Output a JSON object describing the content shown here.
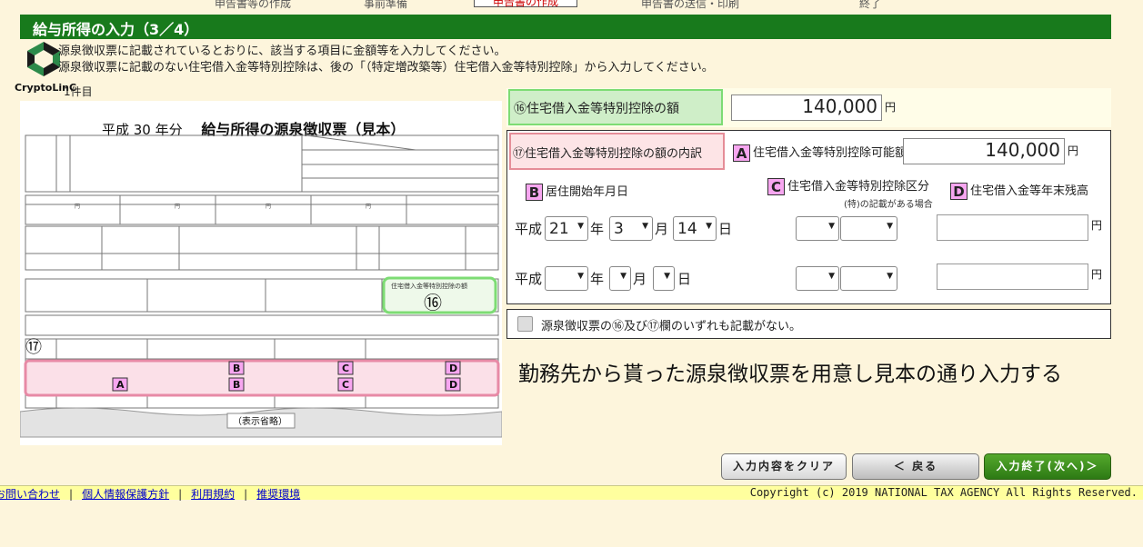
{
  "nav": {
    "items": [
      "申告書等の作成",
      "事前準備",
      "申告書の作成",
      "申告書の送信・印刷",
      "終了"
    ]
  },
  "page": {
    "title": "給与所得の入力（3／4）",
    "note1": "源泉徴収票に記載されているとおりに、該当する項目に金額等を入力してください。",
    "note2": "源泉徴収票に記載のない住宅借入金等特別控除は、後の「（特定増改築等）住宅借入金等特別控除」から入力してください。",
    "item_count": "1件目"
  },
  "logo": {
    "text": "CryptoLinC"
  },
  "sample": {
    "year_label": "平成 30 年分",
    "title": "給与所得の源泉徴収票（見本）",
    "field_16_label": "住宅借入金等特別控除の額",
    "circle_16": "⑯",
    "circle_17": "⑰",
    "omitted": "（表示省略）",
    "badges": [
      "A",
      "B",
      "C",
      "D"
    ]
  },
  "form": {
    "r16_label": "⑯住宅借入金等特別控除の額",
    "r16_value": "140,000",
    "yen": "円",
    "r17_label": "⑰住宅借入金等特別控除の額の内訳",
    "a_label": "住宅借入金等特別控除可能額",
    "a_value": "140,000",
    "b_label": "居住開始年月日",
    "c_label": "住宅借入金等特別控除区分",
    "c_sub": "(特)の記載がある場合",
    "d_label": "住宅借入金等年末残高",
    "era": "平成",
    "year_unit": "年",
    "month_unit": "月",
    "day_unit": "日",
    "row1": {
      "year": "21",
      "month": "3",
      "day": "14",
      "kubun1": "",
      "kubun2": "",
      "balance": ""
    },
    "row2": {
      "year": "",
      "month": "",
      "day": "",
      "kubun1": "",
      "kubun2": "",
      "balance": ""
    },
    "checkbox_label": "源泉徴収票の⑯及び⑰欄のいずれも記載がない。"
  },
  "hint": "勤務先から貰った源泉徴収票を用意し見本の通り入力する",
  "buttons": {
    "clear": "入力内容をクリア",
    "back": "＜ 戻る",
    "next": "入力終了(次へ)＞"
  },
  "footer": {
    "links": [
      "お問い合わせ",
      "個人情報保護方針",
      "利用規約",
      "推奨環境"
    ],
    "copyright": "Copyright (c) 2019 NATIONAL TAX AGENCY All Rights Reserved."
  }
}
